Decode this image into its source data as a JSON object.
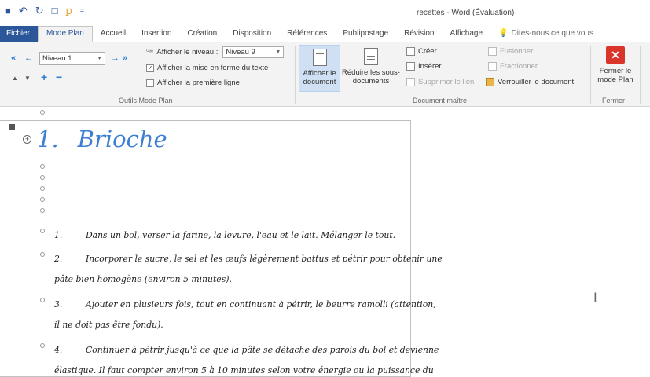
{
  "title_bar": {
    "doc_title": "recettes - Word (Évaluation)",
    "qat": [
      {
        "name": "save-icon",
        "glyph": "🖫"
      },
      {
        "name": "undo-icon",
        "glyph": "↶"
      },
      {
        "name": "redo-icon",
        "glyph": "↻"
      },
      {
        "name": "new-doc-icon",
        "glyph": "🗋"
      },
      {
        "name": "format-painter-icon",
        "glyph": "🖌"
      },
      {
        "name": "qat-customize-icon",
        "glyph": "≡"
      }
    ]
  },
  "tabs": {
    "fichier": "Fichier",
    "mode_plan": "Mode Plan",
    "accueil": "Accueil",
    "insertion": "Insertion",
    "creation": "Création",
    "disposition": "Disposition",
    "references": "Références",
    "publipostage": "Publipostage",
    "revision": "Révision",
    "affichage": "Affichage",
    "tell_me": "Dites-nous ce que vous"
  },
  "ribbon": {
    "outline_tools": {
      "level_value": "Niveau 1",
      "show_level_label": "Afficher le niveau :",
      "show_level_value": "Niveau 9",
      "show_formatting_label": "Afficher la mise en forme du texte",
      "show_formatting_checked": true,
      "first_line_label": "Afficher la première ligne",
      "first_line_checked": false,
      "group_label": "Outils Mode Plan"
    },
    "master_document": {
      "show_document_label": "Afficher le document",
      "collapse_subdocs_label": "Réduire les sous-documents",
      "create_label": "Créer",
      "insert_label": "Insérer",
      "unlink_label": "Supprimer le lien",
      "merge_label": "Fusionner",
      "split_label": "Fractionner",
      "lock_label": "Verrouiller le document",
      "group_label": "Document maître"
    },
    "close": {
      "close_button_label": "Fermer le mode Plan",
      "group_label": "Fermer"
    }
  },
  "document": {
    "heading_number": "1.",
    "heading_text": "Brioche",
    "steps": [
      {
        "num": "1.",
        "line1": "Dans un bol, verser la farine, la levure, l'eau et le lait. Mélanger le tout.",
        "line2": ""
      },
      {
        "num": "2.",
        "line1": "Incorporer le sucre, le sel et les œufs légèrement battus et pétrir pour obtenir une",
        "line2": "pâte bien homogène (environ 5 minutes)."
      },
      {
        "num": "3.",
        "line1": "Ajouter en plusieurs fois, tout en continuant à pétrir, le beurre ramolli (attention,",
        "line2": "il ne doit pas être fondu)."
      },
      {
        "num": "4.",
        "line1": "Continuer à pétrir jusqu'à ce que la pâte se détache des parois du bol et devienne",
        "line2": "élastique. Il faut compter environ 5 à 10 minutes selon votre énergie ou la puissance du"
      }
    ]
  },
  "colors": {
    "ribbon_blue": "#2b579a",
    "heading_blue": "#3d7fd3",
    "close_red": "#d9352b"
  }
}
